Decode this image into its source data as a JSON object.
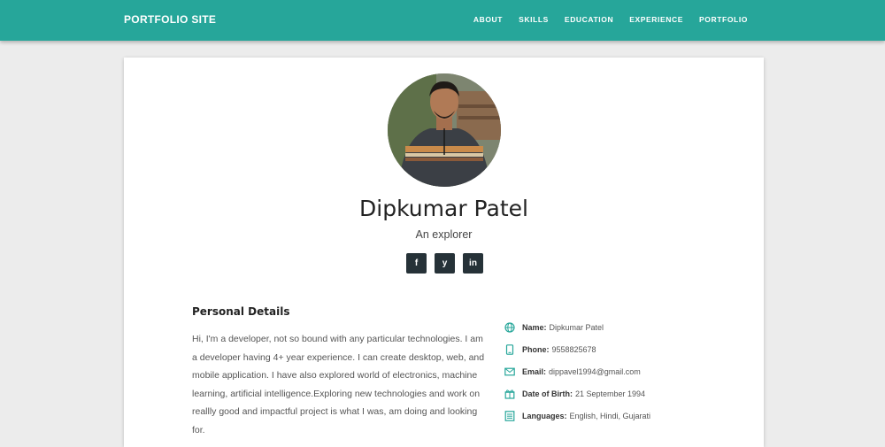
{
  "nav": {
    "brand": "PORTFOLIO SITE",
    "links": [
      "ABOUT",
      "SKILLS",
      "EDUCATION",
      "EXPERIENCE",
      "PORTFOLIO"
    ]
  },
  "profile": {
    "name": "Dipkumar Patel",
    "tagline": "An explorer",
    "socials": [
      {
        "icon": "facebook-icon",
        "glyph": "f"
      },
      {
        "icon": "twitter-icon",
        "glyph": "y"
      },
      {
        "icon": "linkedin-icon",
        "glyph": "in"
      }
    ]
  },
  "personal": {
    "title": "Personal Details",
    "bio": "Hi, I'm a developer, not so bound with any particular technologies. I am a developer having 4+ year experience. I can create desktop, web, and mobile application. I have also explored world of electronics, machine learning, artificial intelligence.Exploring new technologies and work on reallly good and impactful project is what I was, am doing and looking for.",
    "details": [
      {
        "icon": "globe-icon",
        "label": "Name:",
        "value": "Dipkumar Patel"
      },
      {
        "icon": "phone-icon",
        "label": "Phone:",
        "value": "9558825678"
      },
      {
        "icon": "email-icon",
        "label": "Email:",
        "value": "dippavel1994@gmail.com"
      },
      {
        "icon": "gift-icon",
        "label": "Date of Birth:",
        "value": "21 September 1994"
      },
      {
        "icon": "list-icon",
        "label": "Languages:",
        "value": "English, Hindi, Gujarati"
      }
    ]
  },
  "colors": {
    "primary": "#26a69a",
    "dark": "#263238",
    "background": "#ececec"
  }
}
